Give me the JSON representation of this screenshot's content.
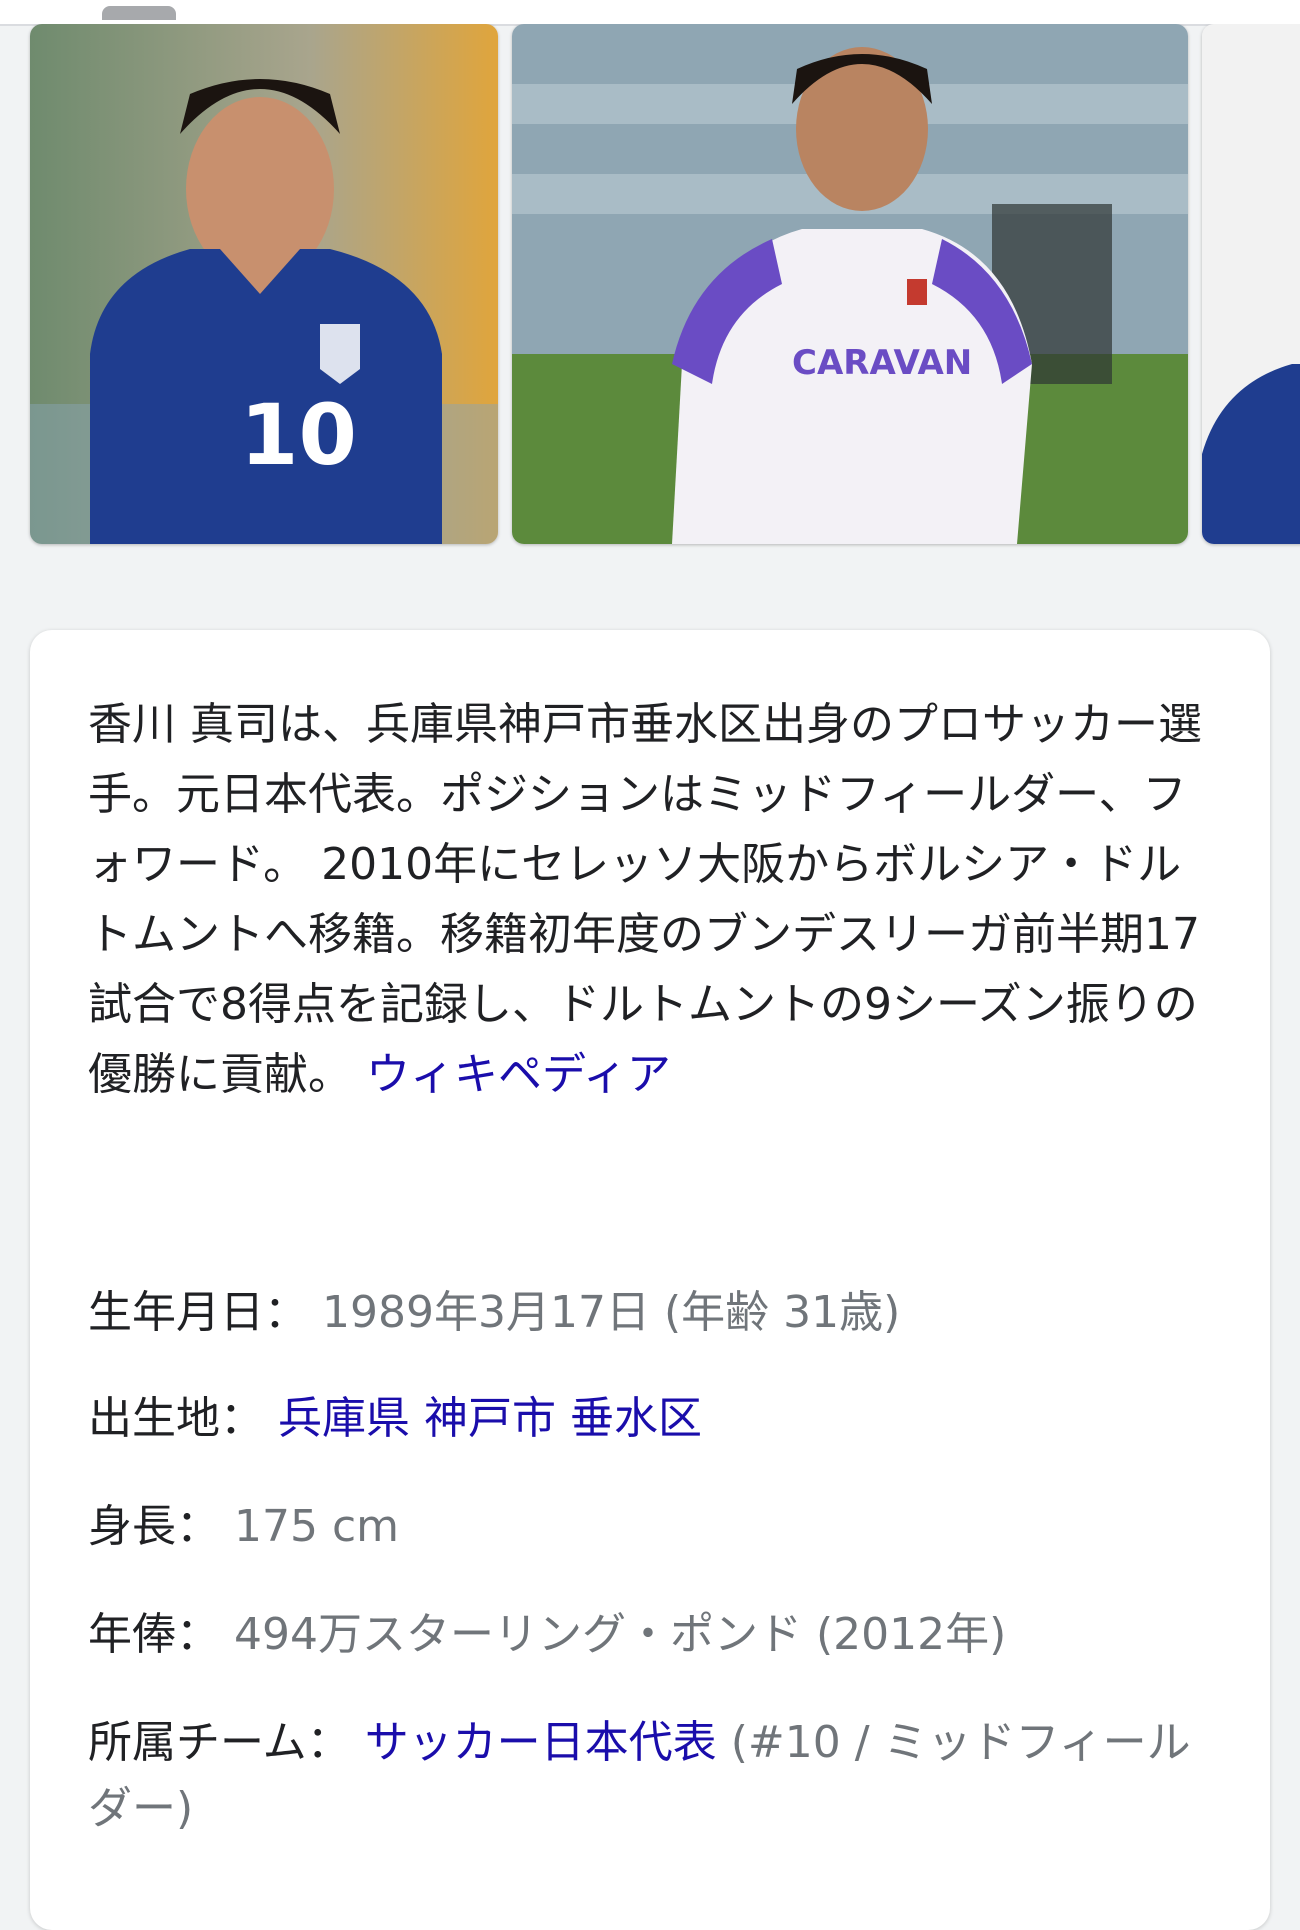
{
  "description": {
    "text": "香川 真司は、兵庫県神戸市垂水区出身のプロサッカー選手。元日本代表。ポジションはミッドフィールダー、フォワード。 2010年にセレッソ大阪からボルシア・ドルトムントへ移籍。移籍初年度のブンデスリーガ前半期17試合で8得点を記録し、ドルトムントの9シーズン振りの優勝に貢献。",
    "source_link": "ウィキペディア"
  },
  "facts": {
    "birth": {
      "label": "生年月日",
      "value": "1989年3月17日 (年齢 31歳)"
    },
    "birthplace": {
      "label": "出生地",
      "links": [
        "兵庫県",
        "神戸市",
        "垂水区"
      ]
    },
    "height": {
      "label": "身長",
      "value": "175 cm"
    },
    "salary": {
      "label": "年俸",
      "value": "494万スターリング・ポンド (2012年)"
    },
    "team": {
      "label": "所属チーム",
      "link": "サッカー日本代表",
      "value": "(#10 / ミッドフィールダー)"
    }
  },
  "colors": {
    "link": "#1a0dab",
    "text": "#202124",
    "secondary": "#70757a",
    "japan_kit": "#1f3d8f",
    "zaragoza_kit": "#6a4cc4"
  }
}
